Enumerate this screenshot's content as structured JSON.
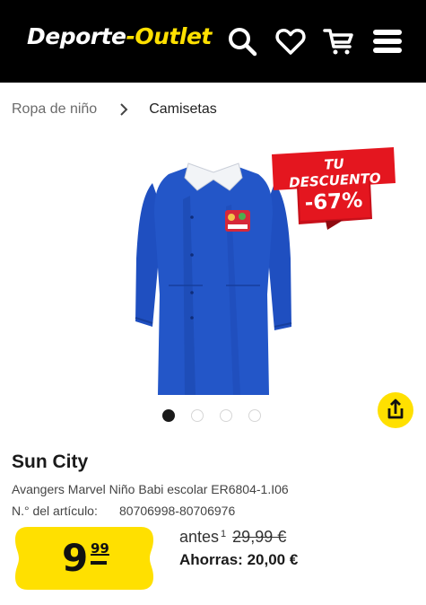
{
  "colors": {
    "header_bg": "#000000",
    "brand_yellow": "#ffe000",
    "discount_red": "#e4161f",
    "product_blue": "#1f4fc0"
  },
  "header": {
    "logo_part1": "Deporte",
    "logo_part2": "-Outlet",
    "icons": [
      "search-icon",
      "heart-icon",
      "cart-icon",
      "menu-icon"
    ]
  },
  "breadcrumb": {
    "parent": "Ropa de niño",
    "current": "Camisetas"
  },
  "gallery": {
    "discount_title": "TU DESCUENTO",
    "discount_value": "-67%",
    "slides": 4,
    "active_slide": 1
  },
  "product": {
    "brand": "Sun City",
    "name": "Avangers Marvel Niño Babi escolar ER6804-1.I06",
    "article_label": "N.° del artículo:",
    "article_number": "80706998-80706976"
  },
  "price": {
    "integer": "9",
    "decimals": "99",
    "before_label": "antes",
    "before_footnote": "1",
    "old_price": "29,99 €",
    "savings": "Ahorras: 20,00 €"
  }
}
